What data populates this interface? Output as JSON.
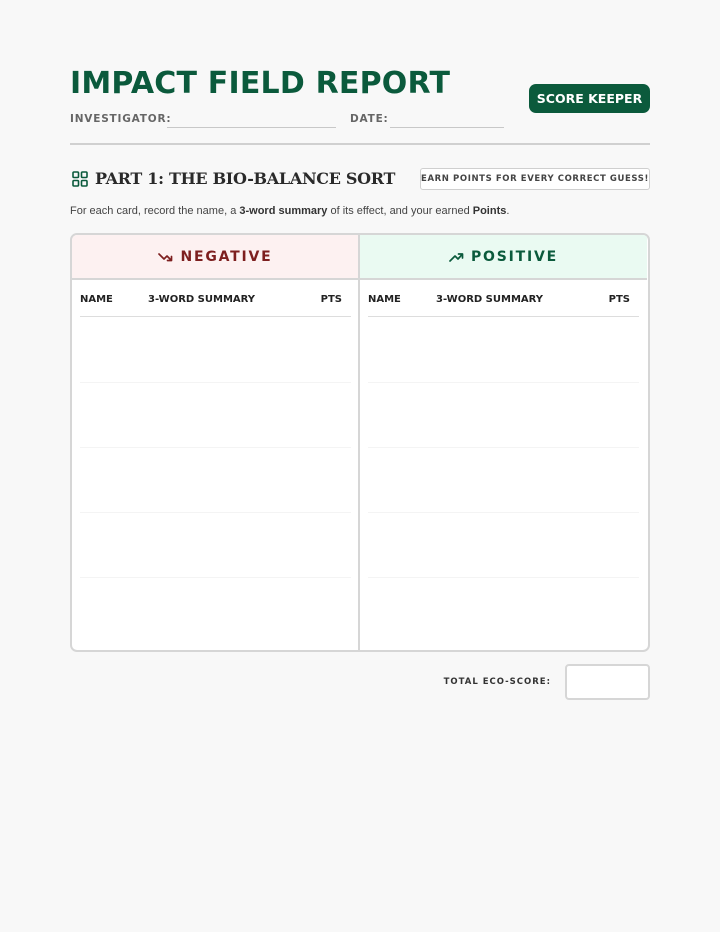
{
  "header": {
    "title": "IMPACT FIELD REPORT",
    "score_button": "SCORE KEEPER",
    "investigator_label": "INVESTIGATOR:",
    "date_label": "DATE:"
  },
  "section": {
    "icon": "grid-icon",
    "title": "PART 1: THE BIO-BALANCE SORT",
    "badge": "EARN POINTS FOR EVERY CORRECT GUESS!",
    "instructions": {
      "pre": "For each card, record the name, a ",
      "bold1": "3-word summary",
      "mid": " of its effect, and your earned ",
      "bold2": "Points",
      "post": "."
    }
  },
  "table": {
    "negative": {
      "label": "NEGATIVE",
      "icon": "trending-down-icon",
      "color": "#7d1f1f",
      "background": "#fdf1f1"
    },
    "positive": {
      "label": "POSITIVE",
      "icon": "trending-up-icon",
      "color": "#0b5a3c",
      "background": "#eafaf2"
    },
    "columns": [
      "NAME",
      "3-WORD SUMMARY",
      "PTS"
    ]
  },
  "total": {
    "label": "TOTAL ECO-SCORE:"
  },
  "colors": {
    "brand": "#0b5a3c",
    "page": "#f8f8f8",
    "border": "#d6d6d6"
  }
}
